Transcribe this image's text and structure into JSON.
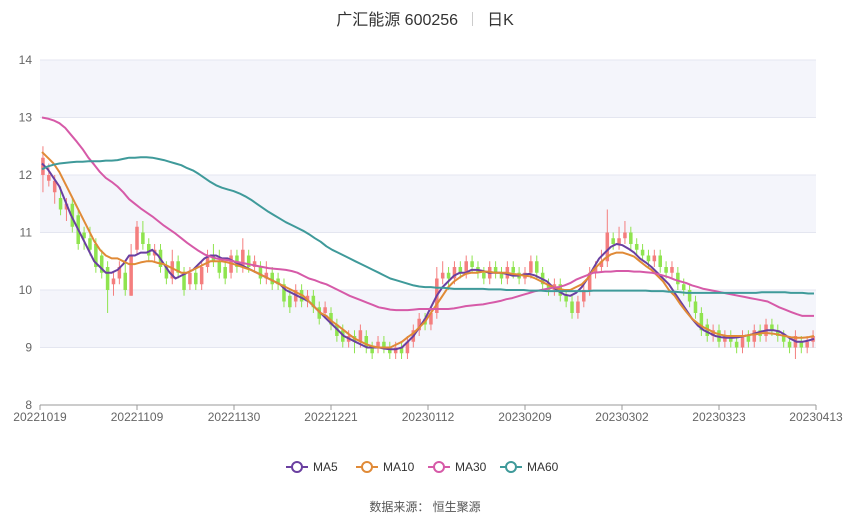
{
  "header": {
    "name": "广汇能源 600256",
    "period": "日K"
  },
  "source_text": "数据来源：  恒生聚源",
  "colors": {
    "up": "#f47e7e",
    "down": "#8fe44f",
    "ma5": "#6a3fa0",
    "ma10": "#e08a37",
    "ma30": "#d65aa8",
    "ma60": "#3f9a9a",
    "band": "#f4f5fb"
  },
  "chart_data": {
    "type": "candlestick",
    "yaxis": {
      "min": 8,
      "max": 14,
      "ticks": [
        8,
        9,
        10,
        11,
        12,
        13,
        14
      ]
    },
    "xaxis": {
      "tick_labels": [
        "20221019",
        "20221109",
        "20221130",
        "20221221",
        "20230112",
        "20230209",
        "20230302",
        "20230323",
        "20230413"
      ]
    },
    "legend": [
      "MA5",
      "MA10",
      "MA30",
      "MA60"
    ],
    "legend_position": "bottom-center",
    "candles": [
      [
        12.0,
        12.3,
        11.7,
        12.5
      ],
      [
        11.9,
        12.0,
        11.8,
        12.2
      ],
      [
        11.7,
        11.9,
        11.5,
        12.0
      ],
      [
        11.6,
        11.4,
        11.3,
        11.8
      ],
      [
        11.4,
        11.5,
        11.2,
        11.6
      ],
      [
        11.5,
        11.1,
        11.0,
        11.6
      ],
      [
        11.3,
        10.8,
        10.7,
        11.4
      ],
      [
        11.0,
        10.9,
        10.7,
        11.1
      ],
      [
        10.9,
        10.7,
        10.6,
        11.1
      ],
      [
        10.8,
        10.4,
        10.3,
        10.9
      ],
      [
        10.6,
        10.3,
        10.2,
        10.7
      ],
      [
        10.4,
        10.0,
        9.6,
        10.5
      ],
      [
        10.1,
        10.2,
        9.9,
        10.3
      ],
      [
        10.2,
        10.4,
        10.1,
        10.5
      ],
      [
        10.3,
        10.0,
        9.9,
        10.5
      ],
      [
        9.9,
        10.6,
        9.9,
        10.8
      ],
      [
        10.7,
        11.1,
        10.6,
        11.2
      ],
      [
        11.0,
        10.8,
        10.7,
        11.2
      ],
      [
        10.8,
        10.6,
        10.5,
        10.9
      ],
      [
        10.6,
        10.7,
        10.5,
        10.8
      ],
      [
        10.7,
        10.4,
        10.3,
        10.8
      ],
      [
        10.4,
        10.2,
        10.1,
        10.5
      ],
      [
        10.2,
        10.5,
        10.1,
        10.7
      ],
      [
        10.5,
        10.3,
        10.2,
        10.6
      ],
      [
        10.3,
        10.0,
        9.9,
        10.4
      ],
      [
        10.1,
        10.3,
        10.0,
        10.4
      ],
      [
        10.3,
        10.1,
        10.0,
        10.4
      ],
      [
        10.1,
        10.4,
        10.0,
        10.5
      ],
      [
        10.4,
        10.6,
        10.3,
        10.7
      ],
      [
        10.6,
        10.5,
        10.4,
        10.8
      ],
      [
        10.5,
        10.3,
        10.2,
        10.7
      ],
      [
        10.4,
        10.2,
        10.1,
        10.5
      ],
      [
        10.3,
        10.6,
        10.2,
        10.7
      ],
      [
        10.6,
        10.4,
        10.3,
        10.7
      ],
      [
        10.4,
        10.7,
        10.3,
        10.9
      ],
      [
        10.6,
        10.4,
        10.3,
        10.7
      ],
      [
        10.4,
        10.5,
        10.3,
        10.6
      ],
      [
        10.4,
        10.2,
        10.1,
        10.5
      ],
      [
        10.2,
        10.3,
        10.1,
        10.5
      ],
      [
        10.3,
        10.1,
        10.0,
        10.4
      ],
      [
        10.2,
        10.1,
        10.0,
        10.3
      ],
      [
        10.1,
        9.8,
        9.7,
        10.2
      ],
      [
        9.9,
        9.7,
        9.6,
        10.0
      ],
      [
        9.8,
        10.0,
        9.7,
        10.1
      ],
      [
        10.0,
        9.8,
        9.7,
        10.1
      ],
      [
        9.8,
        9.9,
        9.7,
        10.0
      ],
      [
        9.9,
        9.7,
        9.6,
        10.0
      ],
      [
        9.7,
        9.5,
        9.4,
        9.8
      ],
      [
        9.6,
        9.7,
        9.5,
        9.8
      ],
      [
        9.6,
        9.4,
        9.3,
        9.7
      ],
      [
        9.4,
        9.2,
        9.1,
        9.5
      ],
      [
        9.3,
        9.1,
        9.0,
        9.4
      ],
      [
        9.1,
        9.2,
        9.0,
        9.3
      ],
      [
        9.2,
        9.1,
        8.9,
        9.3
      ],
      [
        9.1,
        9.3,
        9.0,
        9.4
      ],
      [
        9.2,
        9.0,
        8.9,
        9.3
      ],
      [
        9.0,
        8.9,
        8.8,
        9.1
      ],
      [
        9.0,
        9.1,
        8.9,
        9.2
      ],
      [
        9.1,
        9.0,
        8.9,
        9.2
      ],
      [
        9.0,
        8.9,
        8.8,
        9.1
      ],
      [
        8.9,
        9.0,
        8.8,
        9.1
      ],
      [
        9.0,
        8.9,
        8.8,
        9.1
      ],
      [
        8.9,
        9.1,
        8.8,
        9.2
      ],
      [
        9.1,
        9.3,
        9.0,
        9.4
      ],
      [
        9.3,
        9.5,
        9.2,
        9.6
      ],
      [
        9.5,
        9.4,
        9.3,
        9.6
      ],
      [
        9.4,
        9.6,
        9.3,
        9.7
      ],
      [
        9.6,
        10.2,
        9.5,
        10.4
      ],
      [
        10.2,
        10.3,
        10.1,
        10.5
      ],
      [
        10.3,
        10.2,
        10.0,
        10.4
      ],
      [
        10.2,
        10.4,
        10.1,
        10.5
      ],
      [
        10.4,
        10.3,
        10.2,
        10.5
      ],
      [
        10.3,
        10.5,
        10.2,
        10.6
      ],
      [
        10.5,
        10.4,
        10.3,
        10.6
      ],
      [
        10.4,
        10.3,
        10.2,
        10.5
      ],
      [
        10.3,
        10.2,
        10.1,
        10.4
      ],
      [
        10.2,
        10.4,
        10.1,
        10.5
      ],
      [
        10.4,
        10.3,
        10.2,
        10.5
      ],
      [
        10.3,
        10.2,
        10.1,
        10.4
      ],
      [
        10.2,
        10.4,
        10.1,
        10.5
      ],
      [
        10.4,
        10.3,
        10.2,
        10.5
      ],
      [
        10.3,
        10.2,
        10.1,
        10.4
      ],
      [
        10.2,
        10.3,
        10.1,
        10.4
      ],
      [
        10.3,
        10.5,
        10.2,
        10.6
      ],
      [
        10.5,
        10.3,
        10.2,
        10.6
      ],
      [
        10.3,
        10.1,
        10.0,
        10.4
      ],
      [
        10.1,
        10.0,
        9.9,
        10.2
      ],
      [
        10.0,
        10.1,
        9.9,
        10.2
      ],
      [
        10.1,
        9.9,
        9.8,
        10.2
      ],
      [
        9.9,
        9.8,
        9.7,
        10.0
      ],
      [
        9.8,
        9.6,
        9.5,
        9.9
      ],
      [
        9.6,
        9.8,
        9.5,
        9.9
      ],
      [
        9.8,
        10.0,
        9.7,
        10.1
      ],
      [
        10.0,
        10.3,
        9.9,
        10.4
      ],
      [
        10.3,
        10.4,
        10.2,
        10.5
      ],
      [
        10.4,
        10.5,
        10.3,
        10.7
      ],
      [
        10.5,
        11.0,
        10.4,
        11.4
      ],
      [
        10.9,
        10.8,
        10.7,
        11.0
      ],
      [
        10.8,
        10.9,
        10.7,
        11.1
      ],
      [
        10.9,
        11.0,
        10.8,
        11.2
      ],
      [
        11.0,
        10.8,
        10.7,
        11.1
      ],
      [
        10.8,
        10.7,
        10.6,
        10.9
      ],
      [
        10.7,
        10.6,
        10.5,
        10.8
      ],
      [
        10.6,
        10.5,
        10.4,
        10.7
      ],
      [
        10.5,
        10.6,
        10.4,
        10.7
      ],
      [
        10.6,
        10.4,
        10.3,
        10.7
      ],
      [
        10.4,
        10.3,
        10.2,
        10.5
      ],
      [
        10.3,
        10.4,
        10.2,
        10.5
      ],
      [
        10.3,
        10.1,
        10.0,
        10.4
      ],
      [
        10.1,
        10.0,
        9.9,
        10.2
      ],
      [
        10.0,
        9.8,
        9.7,
        10.1
      ],
      [
        9.8,
        9.6,
        9.5,
        9.9
      ],
      [
        9.6,
        9.3,
        9.2,
        9.7
      ],
      [
        9.4,
        9.2,
        9.1,
        9.5
      ],
      [
        9.2,
        9.3,
        9.1,
        9.4
      ],
      [
        9.3,
        9.1,
        9.0,
        9.4
      ],
      [
        9.1,
        9.2,
        9.0,
        9.3
      ],
      [
        9.2,
        9.1,
        9.0,
        9.3
      ],
      [
        9.1,
        9.0,
        8.9,
        9.2
      ],
      [
        9.0,
        9.2,
        8.9,
        9.3
      ],
      [
        9.2,
        9.1,
        9.0,
        9.3
      ],
      [
        9.1,
        9.3,
        9.0,
        9.4
      ],
      [
        9.3,
        9.2,
        9.1,
        9.4
      ],
      [
        9.2,
        9.4,
        9.1,
        9.5
      ],
      [
        9.4,
        9.3,
        9.2,
        9.5
      ],
      [
        9.3,
        9.2,
        9.1,
        9.4
      ],
      [
        9.2,
        9.1,
        9.0,
        9.3
      ],
      [
        9.1,
        9.0,
        8.9,
        9.2
      ],
      [
        9.0,
        9.2,
        8.8,
        9.3
      ],
      [
        9.1,
        9.0,
        8.9,
        9.2
      ],
      [
        9.0,
        9.1,
        8.9,
        9.2
      ],
      [
        9.1,
        9.2,
        9.0,
        9.3
      ]
    ],
    "series": [
      {
        "name": "MA5",
        "values": [
          12.2,
          12.1,
          11.95,
          11.8,
          11.55,
          11.3,
          11.1,
          10.9,
          10.7,
          10.5,
          10.4,
          10.3,
          10.3,
          10.35,
          10.45,
          10.6,
          10.6,
          10.65,
          10.65,
          10.7,
          10.6,
          10.45,
          10.3,
          10.2,
          10.25,
          10.3,
          10.35,
          10.45,
          10.55,
          10.6,
          10.6,
          10.55,
          10.55,
          10.5,
          10.45,
          10.4,
          10.35,
          10.3,
          10.25,
          10.2,
          10.15,
          10.1,
          10.0,
          9.95,
          9.9,
          9.85,
          9.8,
          9.7,
          9.6,
          9.5,
          9.4,
          9.3,
          9.2,
          9.15,
          9.1,
          9.05,
          9.0,
          9.0,
          9.0,
          8.98,
          8.97,
          8.97,
          9.0,
          9.1,
          9.2,
          9.35,
          9.5,
          9.7,
          9.9,
          10.05,
          10.15,
          10.25,
          10.3,
          10.3,
          10.35,
          10.35,
          10.33,
          10.3,
          10.3,
          10.3,
          10.28,
          10.25,
          10.25,
          10.27,
          10.28,
          10.25,
          10.2,
          10.15,
          10.05,
          9.98,
          9.92,
          9.9,
          9.95,
          10.05,
          10.2,
          10.38,
          10.55,
          10.65,
          10.75,
          10.8,
          10.78,
          10.72,
          10.65,
          10.55,
          10.48,
          10.4,
          10.3,
          10.2,
          10.1,
          9.95,
          9.8,
          9.65,
          9.5,
          9.38,
          9.3,
          9.25,
          9.2,
          9.18,
          9.17,
          9.17,
          9.18,
          9.2,
          9.22,
          9.25,
          9.28,
          9.3,
          9.3,
          9.28,
          9.22,
          9.15,
          9.1,
          9.1,
          9.12,
          9.15
        ]
      },
      {
        "name": "MA10",
        "values": [
          12.4,
          12.3,
          12.2,
          12.05,
          11.85,
          11.65,
          11.45,
          11.25,
          11.05,
          10.85,
          10.7,
          10.6,
          10.55,
          10.55,
          10.5,
          10.45,
          10.45,
          10.48,
          10.5,
          10.5,
          10.47,
          10.45,
          10.4,
          10.35,
          10.3,
          10.3,
          10.35,
          10.4,
          10.45,
          10.5,
          10.5,
          10.5,
          10.48,
          10.45,
          10.42,
          10.38,
          10.35,
          10.3,
          10.25,
          10.2,
          10.15,
          10.1,
          10.05,
          10.0,
          9.95,
          9.9,
          9.8,
          9.7,
          9.6,
          9.55,
          9.45,
          9.38,
          9.3,
          9.22,
          9.15,
          9.1,
          9.05,
          9.02,
          9.0,
          9.0,
          9.0,
          9.05,
          9.1,
          9.18,
          9.25,
          9.35,
          9.45,
          9.6,
          9.75,
          9.9,
          10.05,
          10.15,
          10.22,
          10.28,
          10.3,
          10.3,
          10.32,
          10.32,
          10.3,
          10.3,
          10.3,
          10.28,
          10.27,
          10.25,
          10.24,
          10.2,
          10.15,
          10.1,
          10.05,
          10.02,
          10.0,
          10.0,
          10.05,
          10.1,
          10.2,
          10.35,
          10.45,
          10.55,
          10.62,
          10.65,
          10.65,
          10.62,
          10.58,
          10.5,
          10.42,
          10.35,
          10.25,
          10.15,
          10.0,
          9.9,
          9.75,
          9.62,
          9.5,
          9.42,
          9.35,
          9.3,
          9.25,
          9.22,
          9.2,
          9.2,
          9.2,
          9.2,
          9.22,
          9.23,
          9.25,
          9.25,
          9.24,
          9.22,
          9.2,
          9.18,
          9.17,
          9.17,
          9.18,
          9.2
        ]
      },
      {
        "name": "MA30",
        "values": [
          13.0,
          12.98,
          12.95,
          12.9,
          12.82,
          12.7,
          12.58,
          12.45,
          12.3,
          12.18,
          12.05,
          11.95,
          11.88,
          11.8,
          11.7,
          11.58,
          11.5,
          11.42,
          11.35,
          11.28,
          11.2,
          11.12,
          11.05,
          10.98,
          10.9,
          10.82,
          10.75,
          10.68,
          10.62,
          10.58,
          10.55,
          10.53,
          10.52,
          10.5,
          10.48,
          10.46,
          10.44,
          10.42,
          10.4,
          10.38,
          10.37,
          10.36,
          10.35,
          10.33,
          10.3,
          10.25,
          10.2,
          10.17,
          10.13,
          10.1,
          10.05,
          10.0,
          9.95,
          9.9,
          9.86,
          9.82,
          9.78,
          9.74,
          9.7,
          9.68,
          9.66,
          9.65,
          9.65,
          9.65,
          9.66,
          9.67,
          9.67,
          9.67,
          9.67,
          9.67,
          9.67,
          9.68,
          9.7,
          9.72,
          9.73,
          9.74,
          9.75,
          9.77,
          9.79,
          9.81,
          9.84,
          9.86,
          9.89,
          9.92,
          9.95,
          9.98,
          10.0,
          10.02,
          10.04,
          10.05,
          10.08,
          10.12,
          10.18,
          10.22,
          10.26,
          10.3,
          10.31,
          10.32,
          10.32,
          10.33,
          10.33,
          10.33,
          10.32,
          10.32,
          10.31,
          10.3,
          10.28,
          10.25,
          10.22,
          10.18,
          10.15,
          10.12,
          10.08,
          10.05,
          10.02,
          10.0,
          9.98,
          9.96,
          9.94,
          9.92,
          9.9,
          9.88,
          9.86,
          9.84,
          9.82,
          9.8,
          9.75,
          9.7,
          9.66,
          9.62,
          9.58,
          9.55,
          9.55,
          9.55
        ]
      },
      {
        "name": "MA60",
        "values": [
          12.1,
          12.15,
          12.18,
          12.2,
          12.21,
          12.22,
          12.23,
          12.23,
          12.24,
          12.24,
          12.24,
          12.25,
          12.25,
          12.26,
          12.28,
          12.3,
          12.3,
          12.31,
          12.31,
          12.3,
          12.28,
          12.26,
          12.23,
          12.2,
          12.17,
          12.12,
          12.08,
          12.02,
          11.95,
          11.88,
          11.82,
          11.78,
          11.75,
          11.72,
          11.68,
          11.63,
          11.57,
          11.5,
          11.43,
          11.36,
          11.3,
          11.24,
          11.18,
          11.13,
          11.08,
          11.03,
          10.97,
          10.9,
          10.84,
          10.76,
          10.7,
          10.65,
          10.6,
          10.55,
          10.5,
          10.45,
          10.4,
          10.35,
          10.3,
          10.25,
          10.2,
          10.17,
          10.14,
          10.11,
          10.08,
          10.06,
          10.05,
          10.05,
          10.04,
          10.04,
          10.03,
          10.02,
          10.02,
          10.02,
          10.02,
          10.02,
          10.02,
          10.01,
          10.01,
          10.01,
          10.0,
          10.0,
          10.0,
          10.0,
          9.99,
          9.99,
          9.99,
          9.98,
          9.98,
          9.98,
          9.98,
          9.98,
          9.98,
          9.98,
          9.98,
          9.99,
          9.99,
          9.99,
          9.99,
          9.99,
          9.99,
          9.99,
          9.99,
          9.99,
          9.99,
          9.98,
          9.98,
          9.98,
          9.97,
          9.97,
          9.96,
          9.95,
          9.95,
          9.95,
          9.95,
          9.95,
          9.95,
          9.95,
          9.95,
          9.95,
          9.95,
          9.95,
          9.95,
          9.95,
          9.96,
          9.96,
          9.96,
          9.96,
          9.96,
          9.95,
          9.95,
          9.95,
          9.94,
          9.94
        ]
      }
    ]
  }
}
